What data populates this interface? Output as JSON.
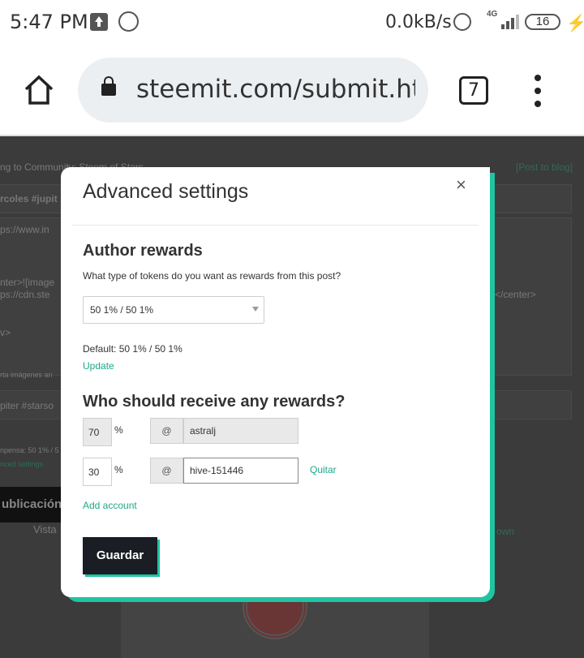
{
  "status_bar": {
    "time": "5:47 PM",
    "net_speed": "0.0kB/s",
    "network_type": "4G",
    "battery": "16"
  },
  "browser": {
    "url": "steemit.com/submit.html",
    "tab_count": "7"
  },
  "background_page": {
    "community_line": "ng to Community: Steem of Stars",
    "post_to_blog": "[Post to blog]",
    "tags_fragment": "rcoles #jupit",
    "body_fragment_1": "ps://www.in",
    "body_fragment_2": "nter>![image",
    "body_fragment_3": "ps://cdn.ste",
    "body_fragment_4": "</center>",
    "body_fragment_5": "v>",
    "body_fragment_6": "rta imágenes an",
    "tags_fragment_2": "piter #starso",
    "reward_fragment": "npensa: 50 1% / 5",
    "advanced_fragment": "nced settings",
    "publish_fragment": "ublicación",
    "preview_fragment": "Vista",
    "markdown_fragment": "own"
  },
  "modal": {
    "title": "Advanced settings",
    "close_label": "×",
    "author_rewards": {
      "heading": "Author rewards",
      "question": "What type of tokens do you want as rewards from this post?",
      "selected_option": "50 1% / 50 1%",
      "default_text": "Default: 50 1% / 50 1%",
      "update_link": "Update"
    },
    "beneficiaries": {
      "heading": "Who should receive any rewards?",
      "rows": [
        {
          "percent": "70",
          "at": "@",
          "account": "astralj",
          "removable": false
        },
        {
          "percent": "30",
          "at": "@",
          "account": "hive-151446",
          "remove_label": "Quitar",
          "removable": true
        }
      ],
      "percent_sign": "%",
      "add_account": "Add account"
    },
    "save_label": "Guardar"
  },
  "colors": {
    "accent": "#1fc4a2",
    "link": "#1fa789",
    "button_bg": "#1a1d23",
    "backdrop": "#3b3b3b"
  }
}
